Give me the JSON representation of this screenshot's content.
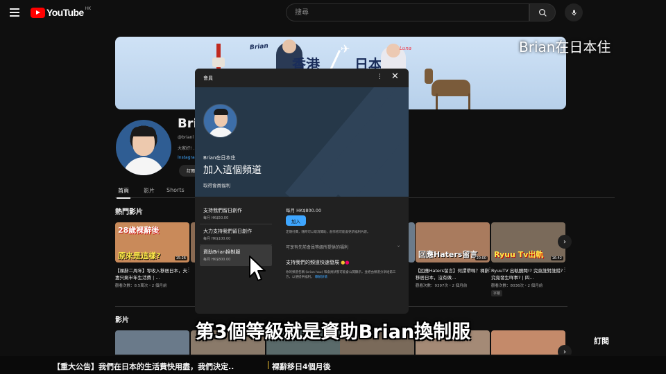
{
  "topbar": {
    "logo_text": "YouTube",
    "region": "HK",
    "search_placeholder": "搜尋"
  },
  "channel": {
    "name": "Bri",
    "handle": "@brianl",
    "description": "大家好! …",
    "links": "Instagra",
    "subscribe_label": "訂閱",
    "tabs": [
      {
        "label": "首頁",
        "active": true
      },
      {
        "label": "影片"
      },
      {
        "label": "Shorts"
      }
    ],
    "banner": {
      "brian_tag": "Brian",
      "luna_tag": "Luna",
      "hk": "香港",
      "jp": "日本"
    }
  },
  "sections": {
    "popular": "熱門影片",
    "videos": "影片"
  },
  "popular_videos": [
    {
      "thumb_top": "28歲裸辭後",
      "thumb_bottom": "原來是這樣?",
      "duration": "15:26",
      "title": "【裸辭二周年】零收入移居日本，夫妻只剩半年生活費 | …",
      "meta": "觀看次數：8.5萬次・2 個月前",
      "bg": "#c98a5a"
    },
    {
      "thumb_top": "",
      "thumb_bottom": "",
      "duration": "",
      "title": "",
      "meta": "",
      "bg": "#8a6a52"
    },
    {
      "thumb_top": "",
      "thumb_bottom": "",
      "duration": "",
      "title": "",
      "meta": "",
      "bg": "#5a6a7a"
    },
    {
      "thumb_top": "",
      "thumb_bottom": "",
      "duration": "",
      "title": "",
      "meta": "",
      "bg": "#6b7b8b"
    },
    {
      "thumb_top": "回應Haters留言",
      "thumb_bottom": "",
      "duration": "20:00",
      "title": "【回應Haters留言】何謂帶嗎？裸辭移居日本，沒有做…",
      "meta": "觀看次數：9397次・2 個月前",
      "bg": "#a97b5e"
    },
    {
      "thumb_top": "Ryuu Tv出軌",
      "thumb_bottom": "",
      "duration": "16:42",
      "title": "RyuuTV 出軌醜聞!? 究竟誰對誰錯? 究竟發生咩事? | 四…",
      "meta": "觀看次數：8036次・2 個月前",
      "badge": "字幕",
      "bg": "#7a6a5a"
    }
  ],
  "modal": {
    "header": "會員",
    "channel_name": "Brian在日本住",
    "join_title": "加入這個頻道",
    "perks": "取得會員福利",
    "tiers": [
      {
        "name": "支持我們留日創作",
        "price": "每月 HK$50.00"
      },
      {
        "name": "大力支持我們留日創作",
        "price": "每月 HK$100.00"
      },
      {
        "name": "資助Brian換制服",
        "price": "每月 HK$800.00",
        "selected": true
      }
    ],
    "detail_price": "每月 HK$800.00",
    "join_label": "加入",
    "note": "定期付費，隨時可以取消贊助，創作者可能會更新福利內容。",
    "benefits": "可享有先前會員等級所提供的福利",
    "support_title": "支持我們的頻道快速發展",
    "support_desc": "你的頻道名稱 (brian hau) 和會員狀態可能會公開顯示，並經由頻道分享給第三方，以便提供福利。",
    "learn_more": "瞭解詳情"
  },
  "overlay": {
    "watermark": "Brian在日本住",
    "caption": "第3個等級就是資助Brian換制服",
    "subscribe_corner": "訂閱",
    "bottom_title_1": "【重大公告】我們在日本的生活費快用盡，我們決定..",
    "bottom_title_2": "裸辭移日4個月後"
  },
  "colors": {
    "accent": "#3ea6ff",
    "brand_red": "#ff0000",
    "background": "#0f0f0f",
    "modal_bg": "#212121",
    "hero_bg": "#263849"
  }
}
